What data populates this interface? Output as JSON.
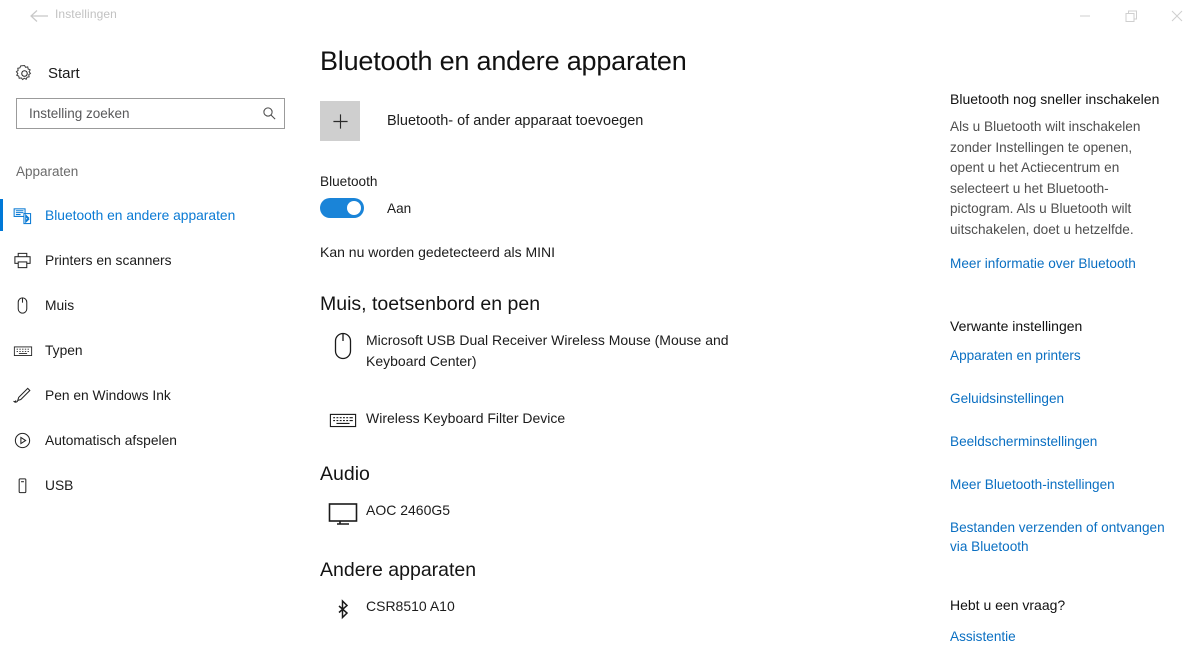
{
  "titlebar": {
    "back_icon": "back-arrow-icon",
    "app_title": "Instellingen",
    "minimize_label": "Minimaliseren",
    "restore_label": "Herstellen",
    "close_label": "Sluiten"
  },
  "sidebar": {
    "start": {
      "label": "Start",
      "icon": "gear-icon"
    },
    "search": {
      "placeholder": "Instelling zoeken",
      "value": "",
      "icon": "search-icon"
    },
    "group_label": "Apparaten",
    "items": [
      {
        "label": "Bluetooth en andere apparaten",
        "icon": "bluetooth-devices-icon",
        "selected": true
      },
      {
        "label": "Printers en scanners",
        "icon": "printer-icon",
        "selected": false
      },
      {
        "label": "Muis",
        "icon": "mouse-icon",
        "selected": false
      },
      {
        "label": "Typen",
        "icon": "keyboard-icon",
        "selected": false
      },
      {
        "label": "Pen en Windows Ink",
        "icon": "pen-icon",
        "selected": false
      },
      {
        "label": "Automatisch afspelen",
        "icon": "autoplay-icon",
        "selected": false
      },
      {
        "label": "USB",
        "icon": "usb-icon",
        "selected": false
      }
    ]
  },
  "main": {
    "page_title": "Bluetooth en andere apparaten",
    "add_device": {
      "label": "Bluetooth- of ander apparaat toevoegen",
      "icon": "plus-icon"
    },
    "bluetooth": {
      "label": "Bluetooth",
      "state": "Aan",
      "enabled": true,
      "discoverable_text": "Kan nu worden gedetecteerd als MINI"
    },
    "sections": [
      {
        "heading": "Muis, toetsenbord en pen",
        "devices": [
          {
            "name": "Microsoft USB Dual Receiver Wireless Mouse (Mouse and Keyboard Center)",
            "icon": "mouse-icon"
          },
          {
            "name": "Wireless Keyboard Filter Device",
            "icon": "keyboard-icon"
          }
        ]
      },
      {
        "heading": "Audio",
        "devices": [
          {
            "name": "AOC 2460G5",
            "icon": "monitor-icon"
          }
        ]
      },
      {
        "heading": "Andere apparaten",
        "devices": [
          {
            "name": "CSR8510 A10",
            "icon": "bluetooth-icon"
          }
        ]
      }
    ]
  },
  "right_panel": {
    "tip_heading": "Bluetooth nog sneller inschakelen",
    "tip_body": "Als u Bluetooth wilt inschakelen zonder Instellingen te openen, opent u het Actiecentrum en selecteert u het Bluetooth-pictogram. Als u Bluetooth wilt uitschakelen, doet u hetzelfde.",
    "tip_link": "Meer informatie over Bluetooth",
    "related_heading": "Verwante instellingen",
    "related_links": [
      "Apparaten en printers",
      "Geluidsinstellingen",
      "Beeldscherminstellingen",
      "Meer Bluetooth-instellingen",
      "Bestanden verzenden of ontvangen via Bluetooth"
    ],
    "question_heading": "Hebt u een vraag?",
    "question_link": "Assistentie"
  },
  "colors": {
    "accent": "#0078d7",
    "link": "#0a6fc2",
    "toggle_on": "#1a84d8",
    "plus_box": "#cfcfcf"
  }
}
